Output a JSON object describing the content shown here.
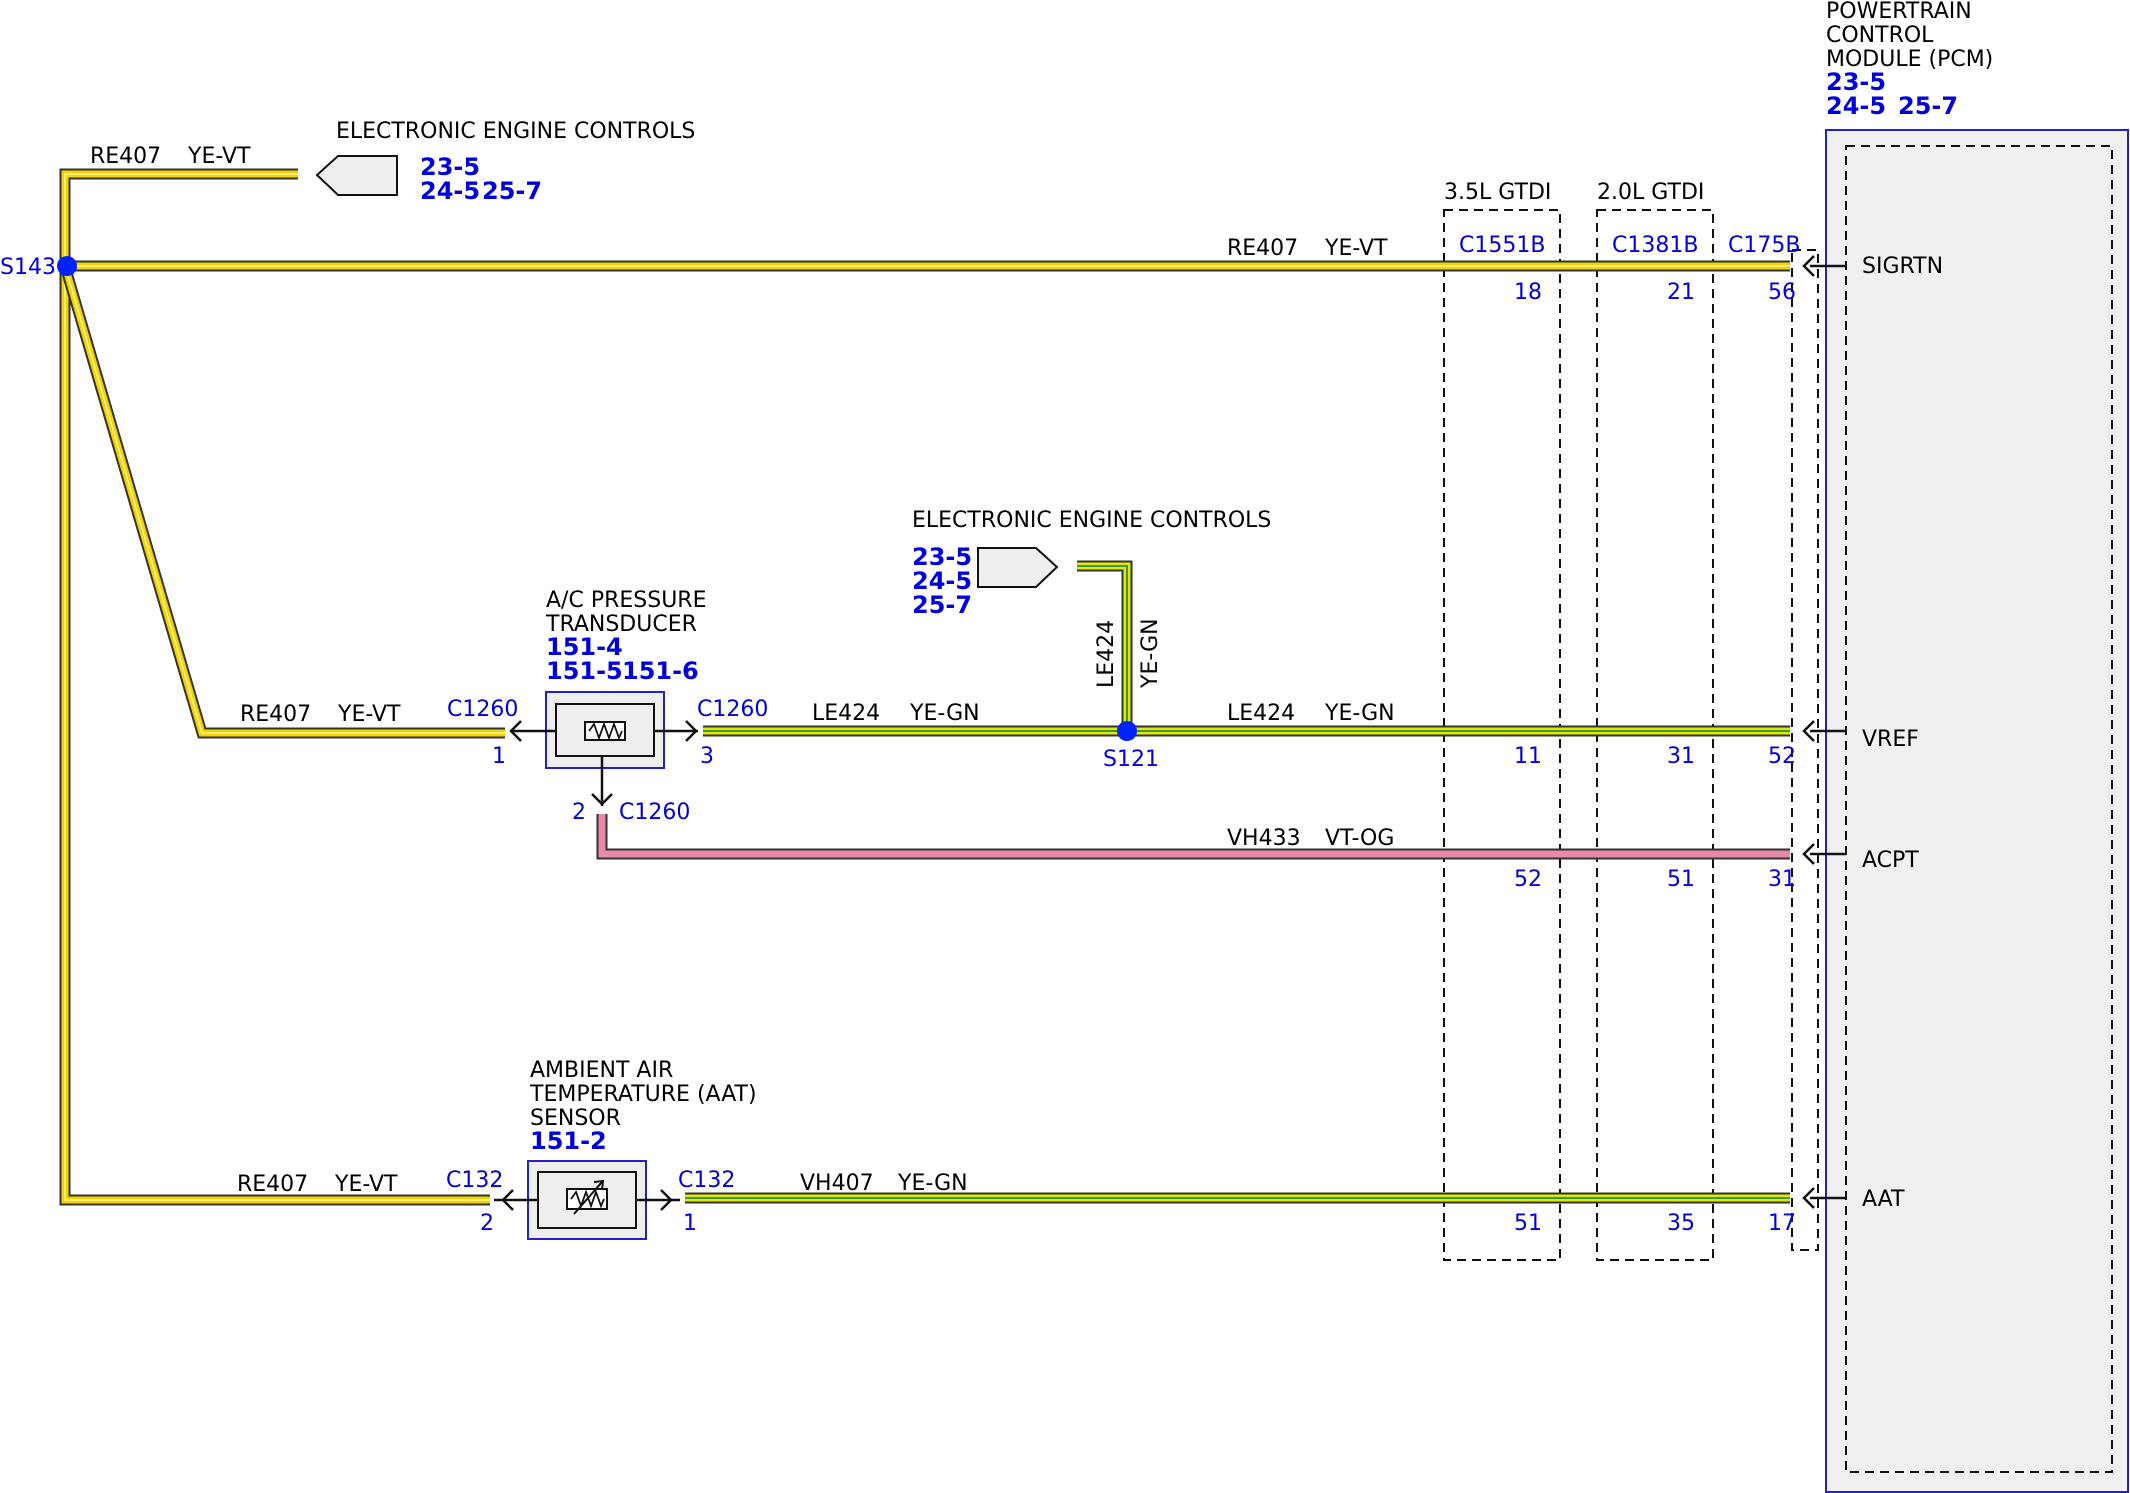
{
  "colors": {
    "wire_ye_vt": "#f5d300",
    "wire_ye_gn": "#e4e800",
    "wire_ye_gn_stripe": "#3c9a3c",
    "wire_vt_og": "#e88aa8",
    "wire_outline": "#333333",
    "label_blue": "#0000dd",
    "splice": "#0022ff",
    "pcm_fill": "#f0f0f0"
  },
  "pcm": {
    "title_lines": [
      "POWERTRAIN",
      "CONTROL",
      "MODULE (PCM)"
    ],
    "refs": [
      "23-5",
      "24-5",
      "25-7"
    ],
    "pins": [
      "SIGRTN",
      "VREF",
      "ACPT",
      "AAT"
    ]
  },
  "inline_connectors": {
    "c1551b": {
      "group_label": "3.5L GTDI",
      "name": "C1551B",
      "pins": [
        "18",
        "11",
        "52",
        "51"
      ]
    },
    "c1381b": {
      "group_label": "2.0L GTDI",
      "name": "C1381B",
      "pins": [
        "21",
        "31",
        "51",
        "35"
      ]
    },
    "c175b": {
      "name": "C175B",
      "pins": [
        "56",
        "52",
        "31",
        "17"
      ]
    }
  },
  "eec_top": {
    "title": "ELECTRONIC ENGINE CONTROLS",
    "refs": [
      "23-5",
      "24-5",
      "25-7"
    ]
  },
  "eec_mid": {
    "title": "ELECTRONIC ENGINE CONTROLS",
    "refs": [
      "23-5",
      "24-5",
      "25-7"
    ]
  },
  "ac_transducer": {
    "title_lines": [
      "A/C PRESSURE",
      "TRANSDUCER"
    ],
    "refs": [
      "151-4",
      "151-5",
      "151-6"
    ],
    "connector": "C1260",
    "pin_left": "1",
    "pin_right": "3",
    "pin_bottom": "2"
  },
  "aat_sensor": {
    "title_lines": [
      "AMBIENT AIR",
      "TEMPERATURE (AAT)",
      "SENSOR"
    ],
    "ref": "151-2",
    "connector": "C132",
    "pin_left": "2",
    "pin_right": "1"
  },
  "splices": {
    "s143": "S143",
    "s121": "S121"
  },
  "wires": {
    "re407_top": {
      "circuit": "RE407",
      "color": "YE-VT"
    },
    "re407_main": {
      "circuit": "RE407",
      "color": "YE-VT"
    },
    "re407_ac": {
      "circuit": "RE407",
      "color": "YE-VT"
    },
    "re407_aat": {
      "circuit": "RE407",
      "color": "YE-VT"
    },
    "le424_left": {
      "circuit": "LE424",
      "color": "YE-GN"
    },
    "le424_vert": {
      "circuit": "LE424",
      "color": "YE-GN"
    },
    "le424_right": {
      "circuit": "LE424",
      "color": "YE-GN"
    },
    "vh433": {
      "circuit": "VH433",
      "color": "VT-OG"
    },
    "vh407": {
      "circuit": "VH407",
      "color": "YE-GN"
    }
  }
}
